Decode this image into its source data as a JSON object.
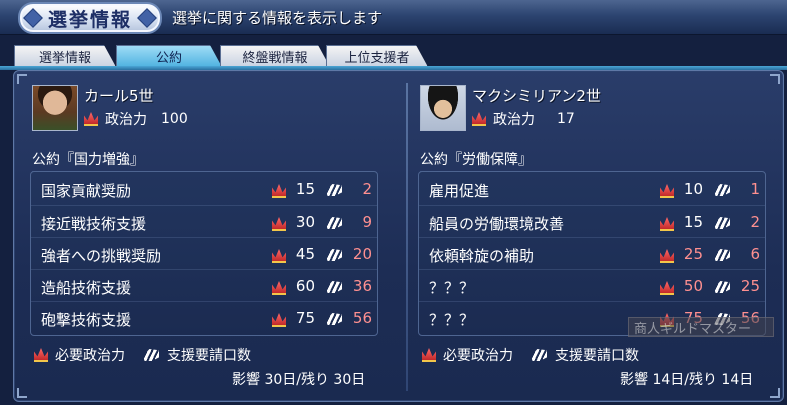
{
  "title": "選挙情報",
  "description": "選挙に関する情報を表示します",
  "tabs": [
    {
      "label": "選挙情報",
      "active": false
    },
    {
      "label": "公約",
      "active": true
    },
    {
      "label": "終盤戦情報",
      "active": false
    },
    {
      "label": "上位支援者",
      "active": false
    }
  ],
  "left": {
    "name": "カール5世",
    "stat_label": "政治力",
    "stat_value": "100",
    "pledge_title": "公約『国力増強』",
    "items": [
      {
        "label": "国家貢献奨励",
        "req": "15",
        "cost": "2"
      },
      {
        "label": "接近戦技術支援",
        "req": "30",
        "cost": "9"
      },
      {
        "label": "強者への挑戦奨励",
        "req": "45",
        "cost": "20"
      },
      {
        "label": "造船技術支援",
        "req": "60",
        "cost": "36"
      },
      {
        "label": "砲撃技術支援",
        "req": "75",
        "cost": "56"
      }
    ],
    "legend_req": "必要政治力",
    "legend_cost": "支援要請口数",
    "effect": "影響  30日/残り  30日"
  },
  "right": {
    "name": "マクシミリアン2世",
    "stat_label": "政治力",
    "stat_value": "17",
    "pledge_title": "公約『労働保障』",
    "items": [
      {
        "label": "雇用促進",
        "req": "10",
        "cost": "1"
      },
      {
        "label": "船員の労働環境改善",
        "req": "15",
        "cost": "2"
      },
      {
        "label": "依頼斡旋の補助",
        "req": "25",
        "cost": "6"
      },
      {
        "label": "？？？",
        "req": "50",
        "cost": "25"
      },
      {
        "label": "？？？",
        "req": "75",
        "cost": "56"
      }
    ],
    "legend_req": "必要政治力",
    "legend_cost": "支援要請口数",
    "effect": "影響  14日/残り  14日"
  },
  "tooltip": "商人ギルドマスター",
  "colors": {
    "background": "#14203f",
    "active_tab": "#4fb2e0",
    "cost_value": "#ff9090",
    "crown": "#c22a2a"
  },
  "icons": {
    "requirement": "crown-icon",
    "cost": "handshake-icon"
  }
}
